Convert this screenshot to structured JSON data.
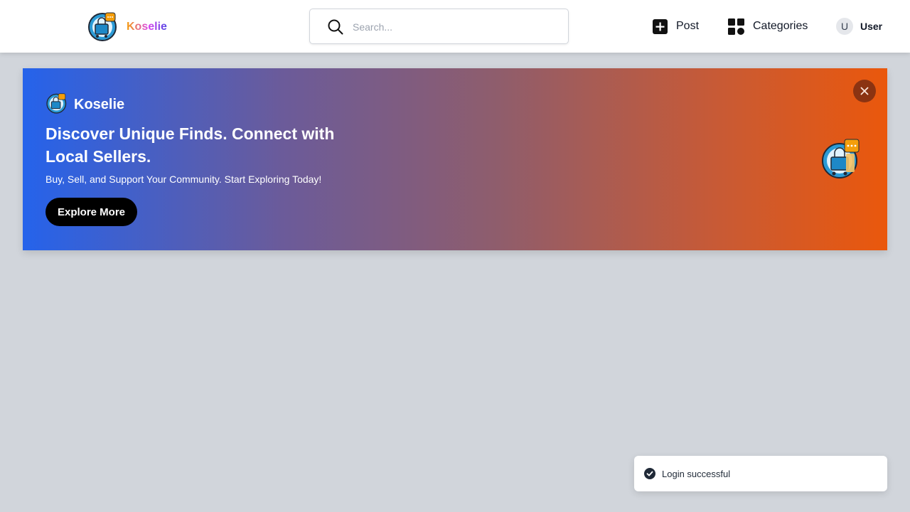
{
  "header": {
    "brand": "Koselie",
    "search_placeholder": "Search...",
    "search_icon": "search-icon",
    "nav": {
      "post_label": "Post",
      "post_icon": "plus-square-icon",
      "categories_label": "Categories",
      "categories_icon": "grid-icon",
      "user_avatar_initial": "U",
      "user_label": "User"
    }
  },
  "banner": {
    "brand": "Koselie",
    "title": "Discover Unique Finds. Connect with Local Sellers.",
    "subtitle": "Buy, Sell, and Support Your Community. Start Exploring Today!",
    "cta_label": "Explore More",
    "close_icon": "close-icon",
    "gradient_start": "#2563eb",
    "gradient_end": "#ea580c"
  },
  "toast": {
    "message": "Login successful",
    "icon": "check-circle-icon"
  },
  "colors": {
    "page_background": "#d1d5db",
    "header_background": "#ffffff",
    "cta_background": "#000000"
  }
}
